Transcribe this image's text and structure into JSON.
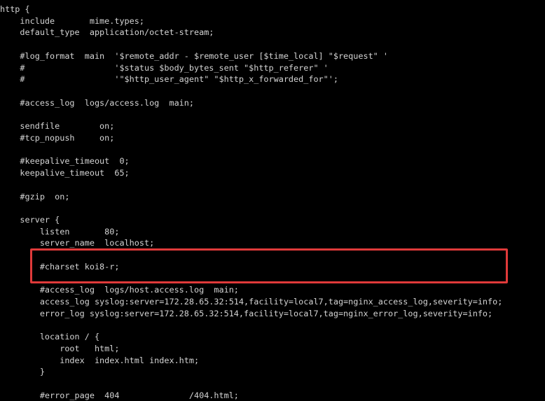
{
  "terminal": {
    "background_color": "#000000",
    "text_color": "#d4d4d4",
    "font_size_px": 11.8,
    "line_height_px": 16.72
  },
  "annotation": {
    "type": "rectangle-highlight",
    "color": "#e03a3a",
    "border_width_px": 3,
    "covers_lines": [
      "#access_log  logs/host.access.log  main;",
      "access_log syslog:server=172.28.65.32:514,facility=local7,tag=nginx_access_log,severity=info;",
      "error_log syslog:server=172.28.65.32:514,facility=local7,tag=nginx_error_log,severity=info;"
    ]
  },
  "config": {
    "filename_context": "nginx.conf http block",
    "lines": [
      "http {",
      "    include       mime.types;",
      "    default_type  application/octet-stream;",
      "",
      "    #log_format  main  '$remote_addr - $remote_user [$time_local] \"$request\" '",
      "    #                  '$status $body_bytes_sent \"$http_referer\" '",
      "    #                  '\"$http_user_agent\" \"$http_x_forwarded_for\"';",
      "",
      "    #access_log  logs/access.log  main;",
      "",
      "    sendfile        on;",
      "    #tcp_nopush     on;",
      "",
      "    #keepalive_timeout  0;",
      "    keepalive_timeout  65;",
      "",
      "    #gzip  on;",
      "",
      "    server {",
      "        listen       80;",
      "        server_name  localhost;",
      "",
      "        #charset koi8-r;",
      "",
      "        #access_log  logs/host.access.log  main;",
      "        access_log syslog:server=172.28.65.32:514,facility=local7,tag=nginx_access_log,severity=info;",
      "        error_log syslog:server=172.28.65.32:514,facility=local7,tag=nginx_error_log,severity=info;",
      "",
      "        location / {",
      "            root   html;",
      "            index  index.html index.htm;",
      "        }",
      "",
      "        #error_page  404              /404.html;"
    ]
  }
}
